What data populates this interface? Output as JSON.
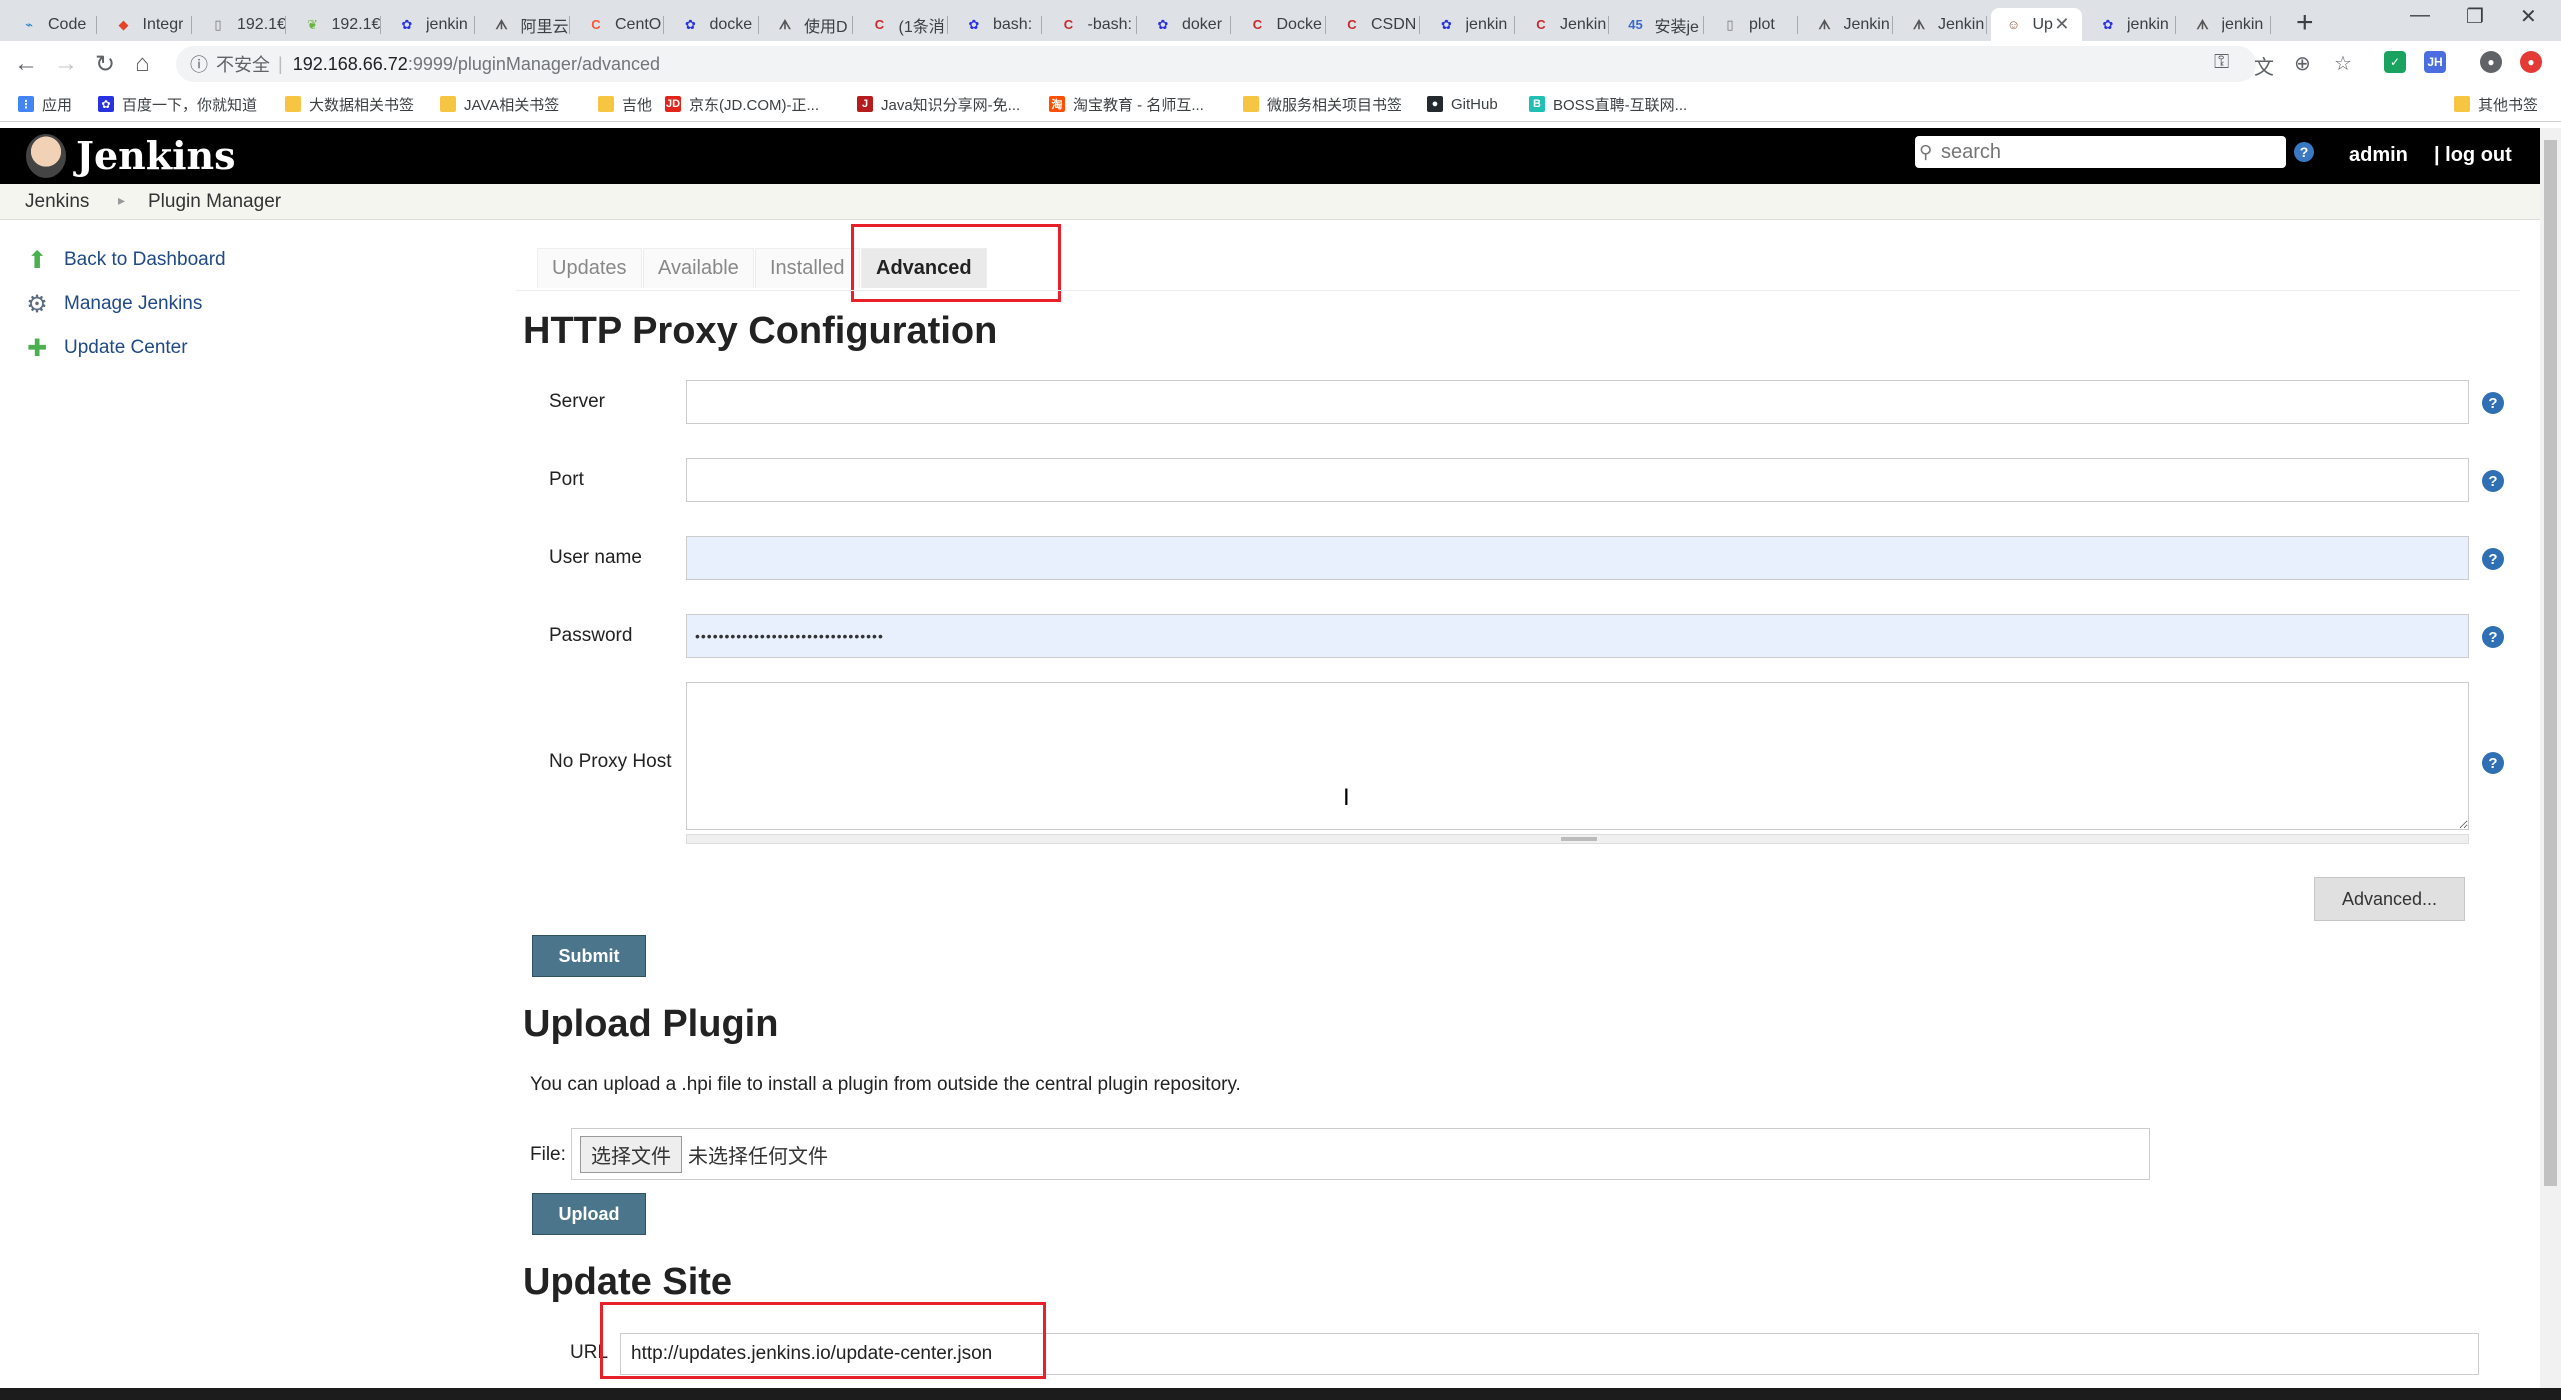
{
  "browser": {
    "tabs": [
      {
        "label": "Code",
        "icon": "code-icon",
        "color": "#2c7fd6",
        "glyph": "⌁"
      },
      {
        "label": "Integr",
        "icon": "gitlab-icon",
        "color": "#e24329",
        "glyph": "◆"
      },
      {
        "label": "192.1€",
        "icon": "page-icon",
        "color": "#777777",
        "glyph": "▯"
      },
      {
        "label": "192.1€",
        "icon": "leaf-icon",
        "color": "#6db33f",
        "glyph": "❦"
      },
      {
        "label": "jenkin",
        "icon": "baidu-icon",
        "color": "#2932e1",
        "glyph": "✿"
      },
      {
        "label": "阿里云",
        "icon": "jenkins-icon",
        "color": "#555555",
        "glyph": "ᗑ"
      },
      {
        "label": "CentO",
        "icon": "csdn-icon",
        "color": "#fc5531",
        "glyph": "C"
      },
      {
        "label": "docke",
        "icon": "baidu-icon",
        "color": "#2932e1",
        "glyph": "✿"
      },
      {
        "label": "使用D",
        "icon": "jenkins-icon",
        "color": "#555555",
        "glyph": "ᗑ"
      },
      {
        "label": "(1条消",
        "icon": "csdn-icon",
        "color": "#c9282d",
        "glyph": "C"
      },
      {
        "label": "bash:",
        "icon": "baidu-icon",
        "color": "#2932e1",
        "glyph": "✿"
      },
      {
        "label": "-bash:",
        "icon": "csdn-icon",
        "color": "#c9282d",
        "glyph": "C"
      },
      {
        "label": "doker",
        "icon": "baidu-icon",
        "color": "#2932e1",
        "glyph": "✿"
      },
      {
        "label": "Docke",
        "icon": "csdn-icon",
        "color": "#c9282d",
        "glyph": "C"
      },
      {
        "label": "CSDN",
        "icon": "csdn-icon",
        "color": "#c9282d",
        "glyph": "C"
      },
      {
        "label": "jenkin",
        "icon": "baidu-icon",
        "color": "#2932e1",
        "glyph": "✿"
      },
      {
        "label": "Jenkin",
        "icon": "csdn-icon",
        "color": "#c9282d",
        "glyph": "C"
      },
      {
        "label": "安装je",
        "icon": "app-icon",
        "color": "#3b6ac9",
        "glyph": "45"
      },
      {
        "label": "plot",
        "icon": "page-icon",
        "color": "#777777",
        "glyph": "▯"
      },
      {
        "label": "Jenkin",
        "icon": "jenkins-icon",
        "color": "#555555",
        "glyph": "ᗑ"
      },
      {
        "label": "Jenkin",
        "icon": "jenkins-icon",
        "color": "#555555",
        "glyph": "ᗑ"
      },
      {
        "label": "Up",
        "icon": "jenkins-butler-icon",
        "color": "#8a5a3c",
        "glyph": "☺",
        "active": true
      },
      {
        "label": "jenkin",
        "icon": "baidu-icon",
        "color": "#2932e1",
        "glyph": "✿"
      },
      {
        "label": "jenkin",
        "icon": "jenkins-icon",
        "color": "#555555",
        "glyph": "ᗑ"
      }
    ],
    "address": {
      "insecure_label": "不安全",
      "host": "192.168.66.72",
      "path": ":9999/pluginManager/advanced"
    },
    "bookmarks": [
      {
        "label": "应用",
        "icon": "apps-grid-icon",
        "color": "#4285f4",
        "glyph": "⋮"
      },
      {
        "label": "百度一下，你就知道",
        "icon": "baidu-icon",
        "color": "#2932e1",
        "glyph": "✿"
      },
      {
        "label": "大数据相关书签",
        "icon": "folder-icon",
        "color": "#f6c643",
        "glyph": ""
      },
      {
        "label": "JAVA相关书签",
        "icon": "folder-icon",
        "color": "#f6c643",
        "glyph": ""
      },
      {
        "label": "吉他",
        "icon": "folder-icon",
        "color": "#f6c643",
        "glyph": ""
      },
      {
        "label": "京东(JD.COM)-正...",
        "icon": "jd-icon",
        "color": "#e1251b",
        "glyph": "JD"
      },
      {
        "label": "Java知识分享网-免...",
        "icon": "java-icon",
        "color": "#b71c1c",
        "glyph": "J"
      },
      {
        "label": "淘宝教育 - 名师互...",
        "icon": "taobao-icon",
        "color": "#ff5000",
        "glyph": "淘"
      },
      {
        "label": "微服务相关项目书签",
        "icon": "folder-icon",
        "color": "#f6c643",
        "glyph": ""
      },
      {
        "label": "GitHub",
        "icon": "github-icon",
        "color": "#24292e",
        "glyph": "●"
      },
      {
        "label": "BOSS直聘-互联网...",
        "icon": "boss-icon",
        "color": "#1fbfb4",
        "glyph": "B"
      },
      {
        "label": "其他书签",
        "icon": "folder-icon",
        "color": "#f6c643",
        "glyph": ""
      }
    ]
  },
  "header": {
    "title": "Jenkins",
    "search_placeholder": "search",
    "user": "admin",
    "logout": "| log out"
  },
  "breadcrumb": [
    "Jenkins",
    "Plugin Manager"
  ],
  "sidebar": [
    {
      "label": "Back to Dashboard",
      "icon": "up-arrow-icon",
      "glyph": "⬆",
      "color": "#4caf50"
    },
    {
      "label": "Manage Jenkins",
      "icon": "gear-icon",
      "glyph": "⚙",
      "color": "#5b6b84"
    },
    {
      "label": "Update Center",
      "icon": "puzzle-icon",
      "glyph": "✚",
      "color": "#4caf50"
    }
  ],
  "tabs": [
    "Updates",
    "Available",
    "Installed",
    "Advanced"
  ],
  "active_tab": "Advanced",
  "proxy": {
    "heading": "HTTP Proxy Configuration",
    "server_label": "Server",
    "port_label": "Port",
    "username_label": "User name",
    "password_label": "Password",
    "password_value": "••••••••••••••••••••••••••••••••",
    "noproxy_label": "No Proxy Host",
    "advanced_button": "Advanced...",
    "submit_button": "Submit"
  },
  "upload": {
    "heading": "Upload Plugin",
    "description": "You can upload a .hpi file to install a plugin from outside the central plugin repository.",
    "file_label": "File:",
    "choose_button": "选择文件",
    "no_file_text": "未选择任何文件",
    "upload_button": "Upload"
  },
  "update_site": {
    "heading": "Update Site",
    "url_label": "URL",
    "url_value": "http://updates.jenkins.io/update-center.json"
  },
  "colors": {
    "highlight_box": "#e8202a",
    "button_blue": "#4b758b",
    "link_blue": "#204a87"
  }
}
